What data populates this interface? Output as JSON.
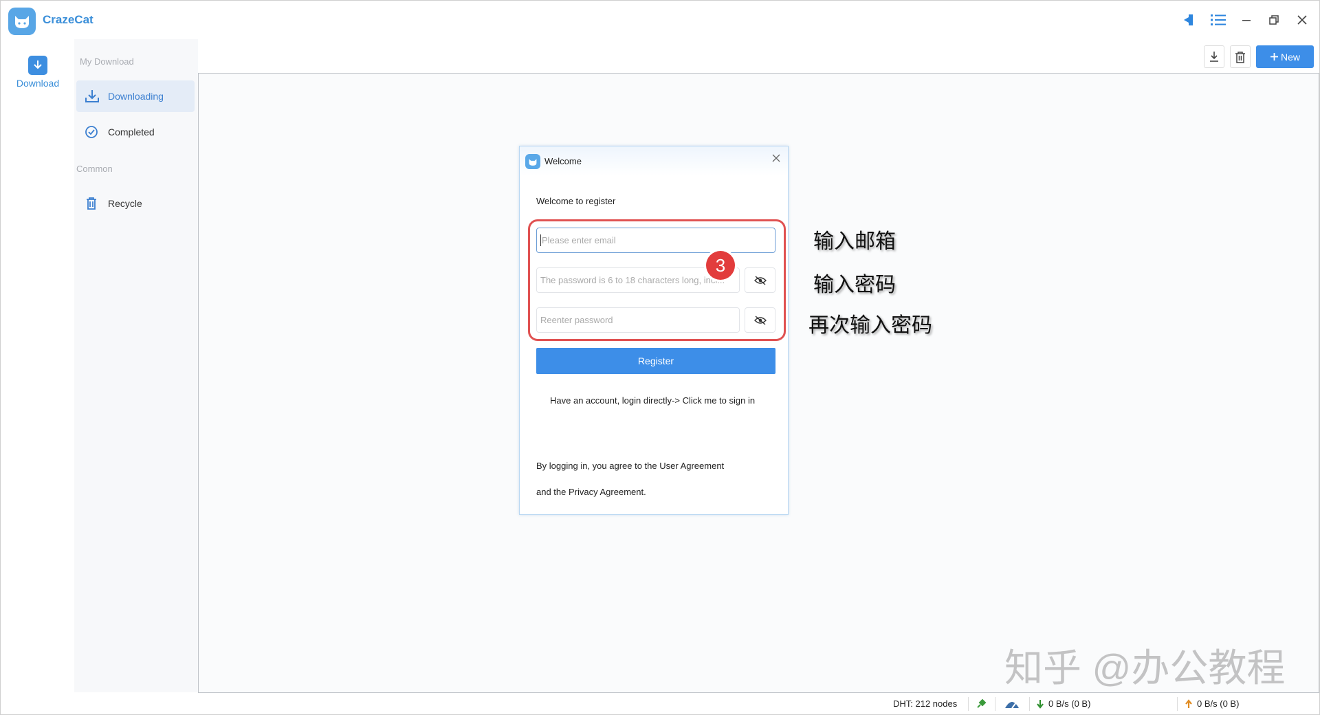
{
  "app": {
    "name": "CrazeCat"
  },
  "titlebar": {
    "icons": [
      "pin-icon",
      "list-view-icon",
      "minimize-icon",
      "restore-icon",
      "close-icon"
    ]
  },
  "rail": {
    "download_label": "Download"
  },
  "sidebar": {
    "my_download_header": "My Download",
    "common_header": "Common",
    "items": [
      {
        "label": "Downloading",
        "icon": "download-icon",
        "active": true
      },
      {
        "label": "Completed",
        "icon": "check-circle-icon",
        "active": false
      },
      {
        "label": "Recycle",
        "icon": "trash-icon",
        "active": false
      }
    ]
  },
  "toolbar": {
    "new_label": "New"
  },
  "dialog": {
    "title": "Welcome",
    "subtitle": "Welcome to register",
    "email_placeholder": "Please enter email",
    "password_placeholder": "The password is 6 to 18 characters long, incl...",
    "reenter_placeholder": "Reenter password",
    "register_label": "Register",
    "login_prompt": "Have an account, login directly->",
    "login_link": "Click me to sign in",
    "agree_line1": "By logging in, you agree to the User Agreement",
    "agree_line2": "and the Privacy Agreement."
  },
  "annotation": {
    "step_number": "3",
    "note_email": "输入邮箱",
    "note_password": "输入密码",
    "note_reenter": "再次输入密码",
    "watermark": "知乎 @办公教程"
  },
  "statusbar": {
    "dht": "DHT: 212 nodes",
    "download_speed": "0 B/s (0 B)",
    "upload_speed": "0 B/s (0 B)"
  },
  "colors": {
    "accent": "#3d8ee8",
    "annotation_red": "#e23c3c"
  }
}
